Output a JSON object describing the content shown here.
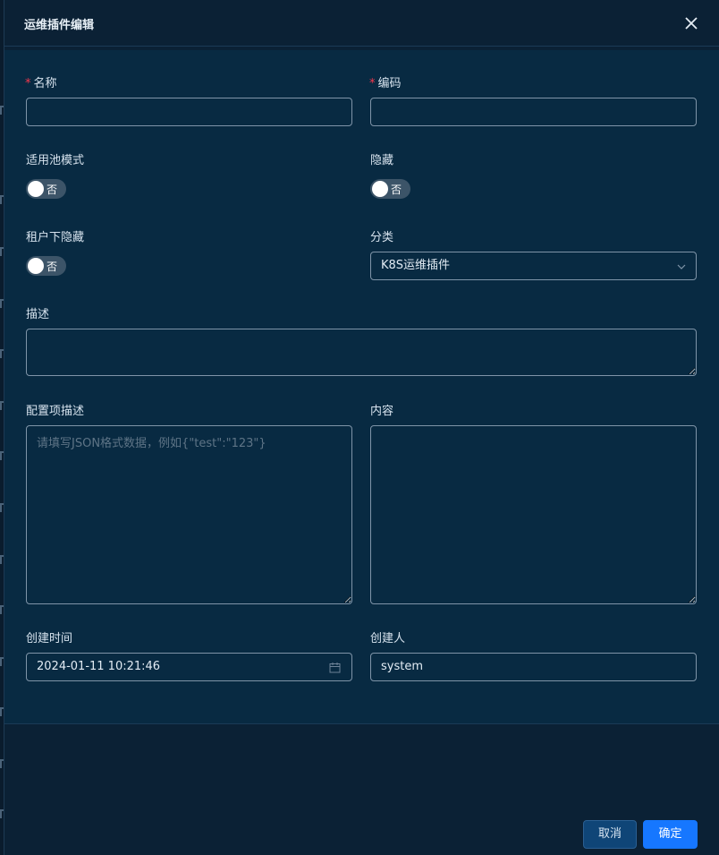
{
  "drawer": {
    "title": "运维插件编辑",
    "close_icon": "close-icon"
  },
  "form": {
    "name": {
      "label": "名称",
      "required": "*",
      "value": ""
    },
    "code": {
      "label": "编码",
      "required": "*",
      "value": ""
    },
    "pool_mode": {
      "label": "适用池模式",
      "switch_text": "否",
      "checked": false
    },
    "hidden": {
      "label": "隐藏",
      "switch_text": "否",
      "checked": false
    },
    "tenant_hidden": {
      "label": "租户下隐藏",
      "switch_text": "否",
      "checked": false
    },
    "category": {
      "label": "分类",
      "value": "K8S运维插件",
      "arrow_icon": "chevron-down-icon"
    },
    "description": {
      "label": "描述",
      "value": ""
    },
    "config_desc": {
      "label": "配置项描述",
      "placeholder": "请填写JSON格式数据，例如{\"test\":\"123\"}",
      "value": ""
    },
    "content": {
      "label": "内容",
      "value": ""
    },
    "created_time": {
      "label": "创建时间",
      "value": "2024-01-11 10:21:46",
      "icon": "calendar-icon"
    },
    "creator": {
      "label": "创建人",
      "value": "system"
    }
  },
  "footer": {
    "cancel_label": "取消",
    "ok_label": "确定"
  },
  "colors": {
    "primary": "#1677ff",
    "required": "#f5384d",
    "panel_bg": "#082a42"
  }
}
